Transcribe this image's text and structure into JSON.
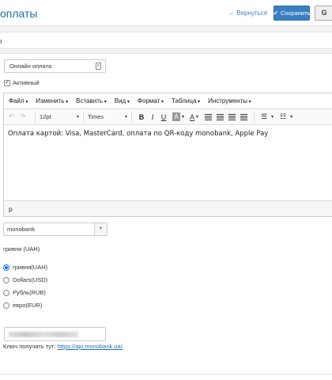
{
  "header": {
    "title": "оплаты",
    "back_label": "← Вернуться",
    "save_label": "Сохранить",
    "extra_label": "G"
  },
  "name_strip": {
    "text": "ı"
  },
  "payment_name": {
    "value": "Онлайн оплата"
  },
  "active": {
    "label": "Активный",
    "checked": true
  },
  "editor": {
    "menu": [
      "Файл",
      "Изменить",
      "Вставить",
      "Вид",
      "Формат",
      "Таблица",
      "Инструменты"
    ],
    "font_size": "12pt",
    "font_family": "Times",
    "content": "Оплата картой: Visa, MasterCard, оплата по QR-коду monobank, Apple Pay",
    "status": "p"
  },
  "module_select": {
    "value": "monobank"
  },
  "currency_label": "гривня (UAH)",
  "currencies": [
    {
      "label": "гривня(UAH)",
      "selected": true
    },
    {
      "label": "Dollars(USD)",
      "selected": false
    },
    {
      "label": "Рубль(RUB)",
      "selected": false
    },
    {
      "label": "евро(EUR)",
      "selected": false
    }
  ],
  "key_hint": {
    "prefix": "Ключ получать тут:",
    "link": "https://api.monobank.ua/"
  }
}
